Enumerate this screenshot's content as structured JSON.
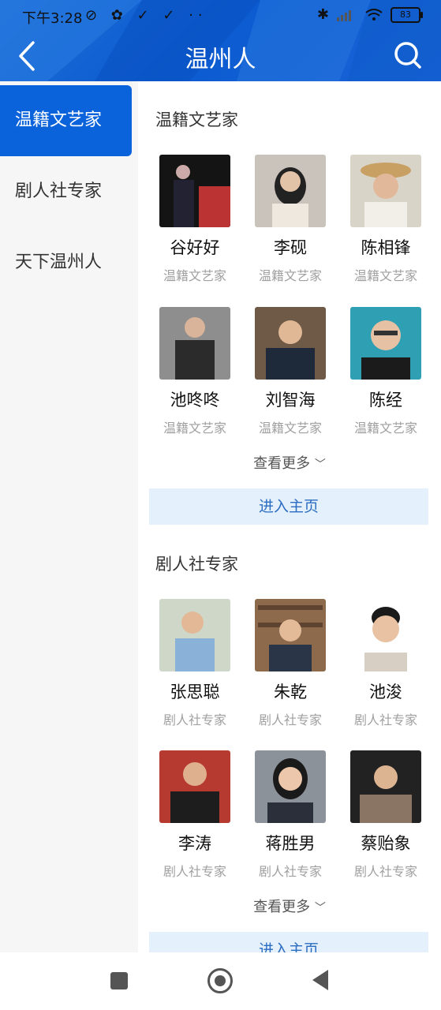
{
  "status": {
    "time": "下午3:28",
    "left_icons": "⊘ ✿ ✓ ✓ ··",
    "battery": "83"
  },
  "header": {
    "title": "温州人"
  },
  "sidebar": {
    "items": [
      {
        "label": "温籍文艺家"
      },
      {
        "label": "剧人社专家"
      },
      {
        "label": "天下温州人"
      }
    ]
  },
  "sections": [
    {
      "title": "温籍文艺家",
      "more": "查看更多",
      "enter": "进入主页",
      "people": [
        {
          "name": "谷好好",
          "tag": "温籍文艺家"
        },
        {
          "name": "李砚",
          "tag": "温籍文艺家"
        },
        {
          "name": "陈相锋",
          "tag": "温籍文艺家"
        },
        {
          "name": "池咚咚",
          "tag": "温籍文艺家"
        },
        {
          "name": "刘智海",
          "tag": "温籍文艺家"
        },
        {
          "name": "陈经",
          "tag": "温籍文艺家"
        }
      ]
    },
    {
      "title": "剧人社专家",
      "more": "查看更多",
      "enter": "进入主页",
      "people": [
        {
          "name": "张思聪",
          "tag": "剧人社专家"
        },
        {
          "name": "朱乾",
          "tag": "剧人社专家"
        },
        {
          "name": "池浚",
          "tag": "剧人社专家"
        },
        {
          "name": "李涛",
          "tag": "剧人社专家"
        },
        {
          "name": "蒋胜男",
          "tag": "剧人社专家"
        },
        {
          "name": "蔡贻象",
          "tag": "剧人社专家"
        }
      ]
    }
  ],
  "colors": {
    "header": "#0b5bd0",
    "active_tab": "#0a63db",
    "enter_bg": "#e4f0fb",
    "enter_text": "#2c6dc2"
  }
}
